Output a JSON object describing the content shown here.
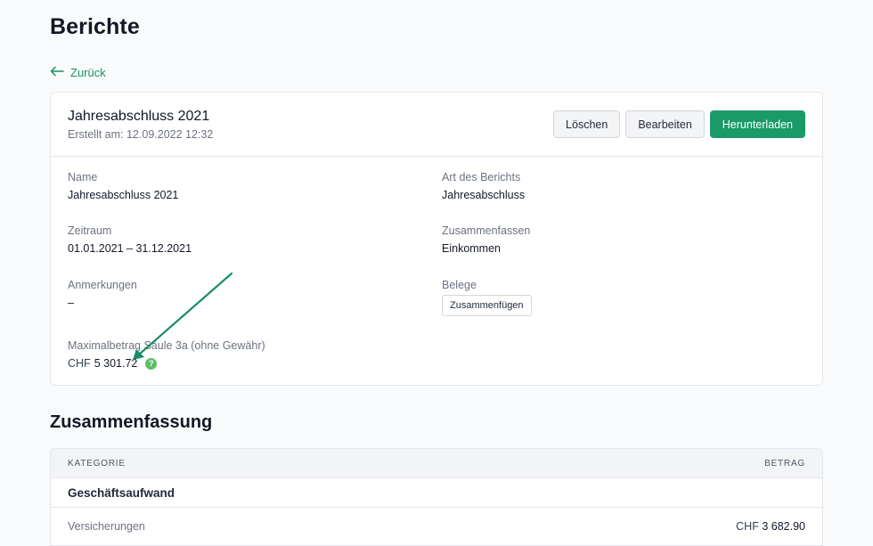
{
  "page": {
    "title": "Berichte",
    "back_label": "Zurück"
  },
  "report": {
    "title": "Jahresabschluss 2021",
    "created": "Erstellt am: 12.09.2022 12:32",
    "actions": {
      "delete": "Löschen",
      "edit": "Bearbeiten",
      "download": "Herunterladen"
    },
    "fields": {
      "name_label": "Name",
      "name_value": "Jahresabschluss 2021",
      "type_label": "Art des Berichts",
      "type_value": "Jahresabschluss",
      "period_label": "Zeitraum",
      "period_value": "01.01.2021 – 31.12.2021",
      "summary_label": "Zusammenfassen",
      "summary_value": "Einkommen",
      "notes_label": "Anmerkungen",
      "notes_value": "–",
      "receipts_label": "Belege",
      "receipts_button": "Zusammenfügen",
      "max_label": "Maximalbetrag Säule 3a (ohne Gewähr)",
      "max_currency": "CHF",
      "max_amount": "5 301.72",
      "help_glyph": "?"
    }
  },
  "summary": {
    "title": "Zusammenfassung",
    "columns": {
      "category": "KATEGORIE",
      "amount": "BETRAG"
    },
    "group": "Geschäftsaufwand",
    "rows": [
      {
        "label": "Versicherungen",
        "currency": "CHF",
        "amount": "3 682.90"
      }
    ]
  },
  "colors": {
    "accent": "#1a9a68",
    "link": "#16935f",
    "annotation_arrow": "#1a8f64",
    "help_icon": "#5bbf63"
  },
  "icons": {
    "back": "arrow-left-icon",
    "help": "help-circle-icon"
  }
}
